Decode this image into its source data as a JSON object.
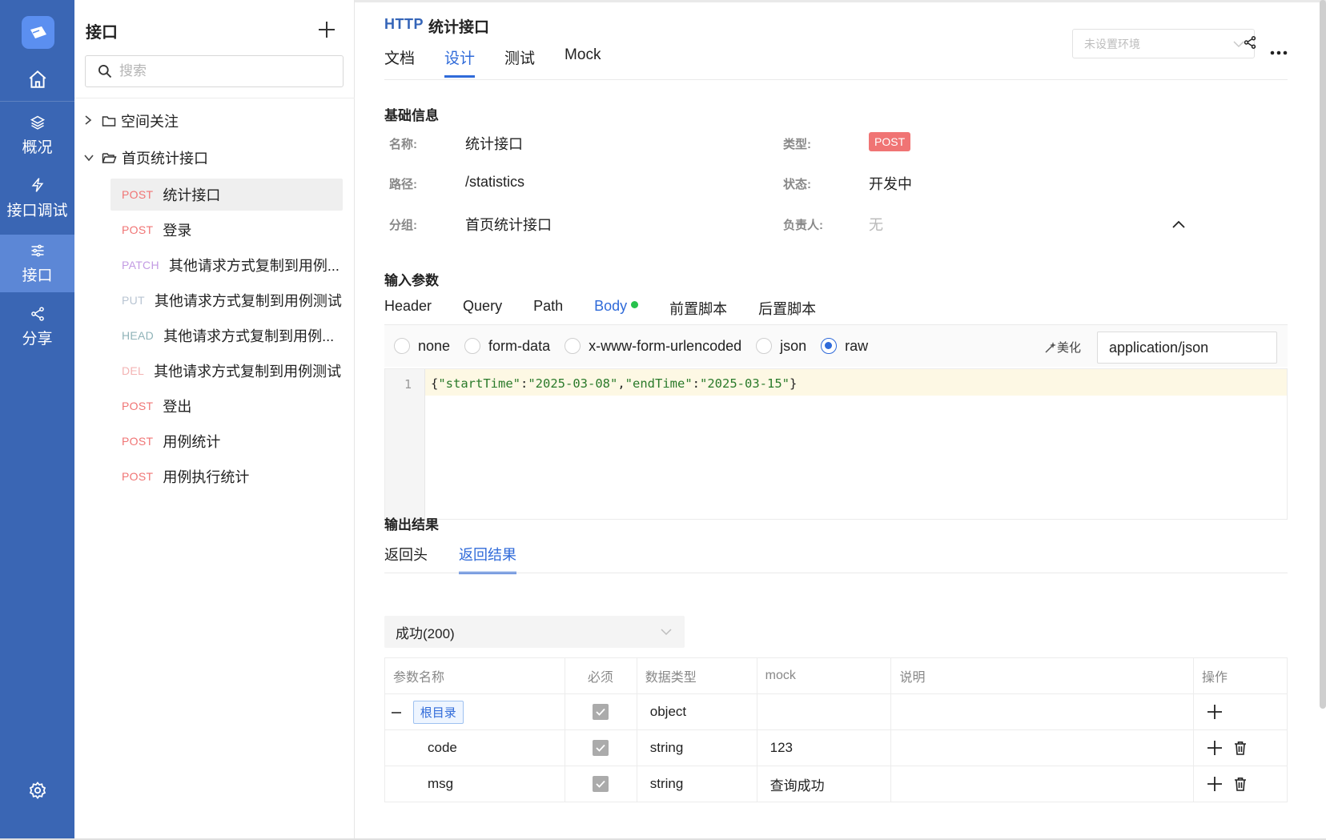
{
  "nav": {
    "items": [
      {
        "id": "home",
        "label": "",
        "icon": "home-icon"
      },
      {
        "id": "overview",
        "label": "概况",
        "icon": "layers-icon"
      },
      {
        "id": "debug",
        "label": "接口调试",
        "icon": "lightning-icon"
      },
      {
        "id": "api",
        "label": "接口",
        "icon": "sliders-icon",
        "active": true
      },
      {
        "id": "share",
        "label": "分享",
        "icon": "share-icon"
      }
    ],
    "settings_icon": "gear-icon"
  },
  "tree": {
    "title": "接口",
    "search_placeholder": "搜索",
    "folders": [
      {
        "label": "空间关注",
        "expanded": false
      },
      {
        "label": "首页统计接口",
        "expanded": true
      }
    ],
    "apis": [
      {
        "method": "POST",
        "name": "统计接口",
        "color": "#f07474",
        "selected": true
      },
      {
        "method": "POST",
        "name": "登录",
        "color": "#f07474"
      },
      {
        "method": "PATCH",
        "name": "其他请求方式复制到用例...",
        "color": "#c39be3"
      },
      {
        "method": "PUT",
        "name": "其他请求方式复制到用例测试",
        "color": "#b8c4d2"
      },
      {
        "method": "HEAD",
        "name": "其他请求方式复制到用例...",
        "color": "#8fb3b8"
      },
      {
        "method": "DEL",
        "name": "其他请求方式复制到用例测试",
        "color": "#f3b3b3"
      },
      {
        "method": "POST",
        "name": "登出",
        "color": "#f07474"
      },
      {
        "method": "POST",
        "name": "用例统计",
        "color": "#f07474"
      },
      {
        "method": "POST",
        "name": "用例执行统计",
        "color": "#f07474"
      }
    ]
  },
  "header": {
    "protocol": "HTTP",
    "name": "统计接口",
    "env_placeholder": "未设置环境",
    "tabs": [
      "文档",
      "设计",
      "测试",
      "Mock"
    ],
    "active_tab": "设计"
  },
  "basic": {
    "title": "基础信息",
    "name_label": "名称:",
    "name_value": "统计接口",
    "type_label": "类型:",
    "type_value": "POST",
    "path_label": "路径:",
    "path_value": "/statistics",
    "status_label": "状态:",
    "status_value": "开发中",
    "group_label": "分组:",
    "group_value": "首页统计接口",
    "owner_label": "负责人:",
    "owner_value": "无"
  },
  "input": {
    "title": "输入参数",
    "tabs": [
      "Header",
      "Query",
      "Path",
      "Body",
      "前置脚本",
      "后置脚本"
    ],
    "active_tab": "Body",
    "body_types": [
      "none",
      "form-data",
      "x-www-form-urlencoded",
      "json",
      "raw"
    ],
    "selected_body_type": "raw",
    "beautify_label": "美化",
    "content_type": "application/json",
    "code_line_number": "1",
    "code": "{\"startTime\":\"2025-03-08\",\"endTime\":\"2025-03-15\"}"
  },
  "output": {
    "title": "输出结果",
    "tabs": [
      "返回头",
      "返回结果"
    ],
    "active_tab": "返回结果",
    "status_select": "成功(200)",
    "columns": [
      "参数名称",
      "必须",
      "数据类型",
      "mock",
      "说明",
      "操作"
    ],
    "rows": [
      {
        "name": "根目录",
        "required": true,
        "type": "object",
        "mock": "",
        "desc": "",
        "root": true
      },
      {
        "name": "code",
        "required": true,
        "type": "string",
        "mock": "123",
        "desc": ""
      },
      {
        "name": "msg",
        "required": true,
        "type": "string",
        "mock": "查询成功",
        "desc": ""
      }
    ]
  },
  "colors": {
    "nav_bg": "#3a66b4",
    "accent": "#2f6ad9",
    "post": "#f07474"
  }
}
